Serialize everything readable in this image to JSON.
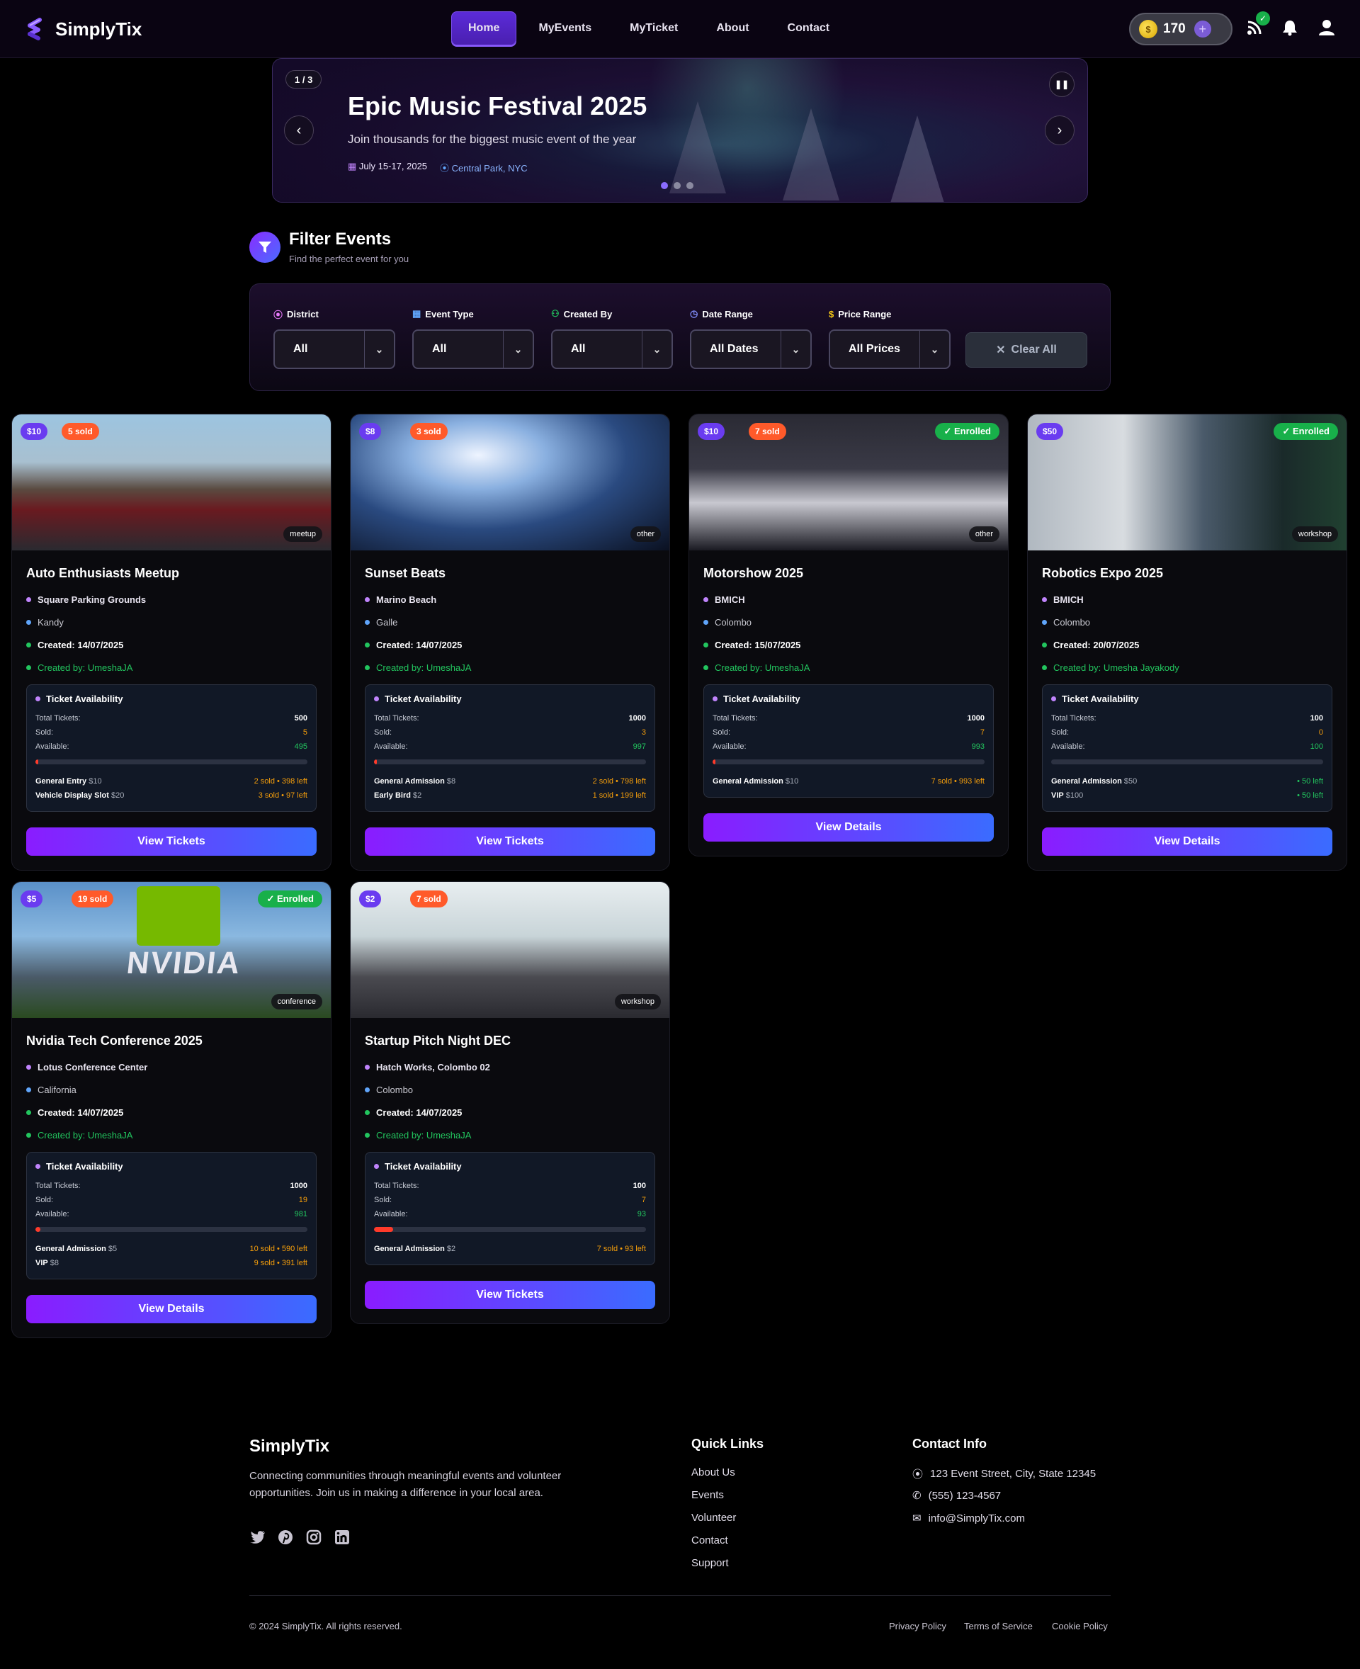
{
  "brand": "SimplyTix",
  "nav": {
    "links": [
      "Home",
      "MyEvents",
      "MyTicket",
      "About",
      "Contact"
    ],
    "active": "Home"
  },
  "coins": "170",
  "hero": {
    "counter": "1 / 3",
    "title": "Epic Music Festival 2025",
    "subtitle": "Join thousands for the biggest music event of the year",
    "date": "July 15-17, 2025",
    "location": "Central Park, NYC"
  },
  "filter": {
    "title": "Filter Events",
    "subtitle": "Find the perfect event for you",
    "groups": [
      {
        "label": "District",
        "value": "All",
        "icon": "map-pin-icon",
        "color": "#e879f9"
      },
      {
        "label": "Event Type",
        "value": "All",
        "icon": "calendar-icon",
        "color": "#60a5fa"
      },
      {
        "label": "Created By",
        "value": "All",
        "icon": "users-icon",
        "color": "#22c55e"
      },
      {
        "label": "Date Range",
        "value": "All Dates",
        "icon": "clock-icon",
        "color": "#818cf8"
      },
      {
        "label": "Price Range",
        "value": "All Prices",
        "icon": "dollar-icon",
        "color": "#facc15"
      }
    ],
    "clear": "Clear All"
  },
  "events": [
    {
      "price": "$10",
      "sold_badge": "5 sold",
      "enrolled": "",
      "type": "meetup",
      "title": "Auto Enthusiasts Meetup",
      "venue": "Square Parking Grounds",
      "city": "Kandy",
      "created": "Created: 14/07/2025",
      "creator": "Created by: UmeshaJA",
      "availability_title": "Ticket Availability",
      "total": "500",
      "sold": "5",
      "available": "495",
      "sold_fraction": 0.01,
      "tiers": [
        {
          "name": "General Entry",
          "price": "$10",
          "status": "2 sold • 398 left"
        },
        {
          "name": "Vehicle Display Slot",
          "price": "$20",
          "status": "3 sold • 97 left"
        }
      ],
      "button": "View Tickets"
    },
    {
      "price": "$8",
      "sold_badge": "3 sold",
      "enrolled": "",
      "type": "other",
      "title": "Sunset Beats",
      "venue": "Marino Beach",
      "city": "Galle",
      "created": "Created: 14/07/2025",
      "creator": "Created by: UmeshaJA",
      "availability_title": "Ticket Availability",
      "total": "1000",
      "sold": "3",
      "available": "997",
      "sold_fraction": 0.003,
      "tiers": [
        {
          "name": "General Admission",
          "price": "$8",
          "status": "2 sold • 798 left"
        },
        {
          "name": "Early Bird",
          "price": "$2",
          "status": "1 sold • 199 left"
        }
      ],
      "button": "View Tickets"
    },
    {
      "price": "$10",
      "sold_badge": "7 sold",
      "enrolled": "✓ Enrolled",
      "type": "other",
      "title": "Motorshow 2025",
      "venue": "BMICH",
      "city": "Colombo",
      "created": "Created: 15/07/2025",
      "creator": "Created by: UmeshaJA",
      "availability_title": "Ticket Availability",
      "total": "1000",
      "sold": "7",
      "available": "993",
      "sold_fraction": 0.007,
      "tiers": [
        {
          "name": "General Admission",
          "price": "$10",
          "status": "7 sold • 993 left"
        }
      ],
      "button": "View Details"
    },
    {
      "price": "$50",
      "sold_badge": "",
      "enrolled": "✓ Enrolled",
      "type": "workshop",
      "title": "Robotics Expo 2025",
      "venue": "BMICH",
      "city": "Colombo",
      "created": "Created: 20/07/2025",
      "creator": "Created by: Umesha Jayakody",
      "availability_title": "Ticket Availability",
      "total": "100",
      "sold": "0",
      "available": "100",
      "sold_fraction": 0,
      "tiers": [
        {
          "name": "General Admission",
          "price": "$50",
          "status": "• 50 left"
        },
        {
          "name": "VIP",
          "price": "$100",
          "status": "• 50 left"
        }
      ],
      "button": "View Details"
    },
    {
      "price": "$5",
      "sold_badge": "19 sold",
      "enrolled": "✓ Enrolled",
      "type": "conference",
      "title": "Nvidia Tech Conference 2025",
      "venue": "Lotus Conference Center",
      "city": "California",
      "created": "Created: 14/07/2025",
      "creator": "Created by: UmeshaJA",
      "availability_title": "Ticket Availability",
      "total": "1000",
      "sold": "19",
      "available": "981",
      "sold_fraction": 0.019,
      "tiers": [
        {
          "name": "General Admission",
          "price": "$5",
          "status": "10 sold • 590 left"
        },
        {
          "name": "VIP",
          "price": "$8",
          "status": "9 sold • 391 left"
        }
      ],
      "button": "View Details",
      "image_text": "NVIDIA"
    },
    {
      "price": "$2",
      "sold_badge": "7 sold",
      "enrolled": "",
      "type": "workshop",
      "title": "Startup Pitch Night DEC",
      "venue": "Hatch Works, Colombo 02",
      "city": "Colombo",
      "created": "Created: 14/07/2025",
      "creator": "Created by: UmeshaJA",
      "availability_title": "Ticket Availability",
      "total": "100",
      "sold": "7",
      "available": "93",
      "sold_fraction": 0.07,
      "tiers": [
        {
          "name": "General Admission",
          "price": "$2",
          "status": "7 sold • 93 left"
        }
      ],
      "button": "View Tickets"
    }
  ],
  "labels": {
    "total": "Total Tickets:",
    "sold": "Sold:",
    "available": "Available:"
  },
  "footer": {
    "brand": "SimplyTix",
    "description": "Connecting communities through meaningful events and volunteer opportunities. Join us in making a difference in your local area.",
    "quick_links_title": "Quick Links",
    "quick_links": [
      "About Us",
      "Events",
      "Volunteer",
      "Contact",
      "Support"
    ],
    "contact_title": "Contact Info",
    "address": "123 Event Street, City, State 12345",
    "phone": "(555) 123-4567",
    "email": "info@SimplyTix.com",
    "copyright": "© 2024 SimplyTix. All rights reserved.",
    "legal": [
      "Privacy Policy",
      "Terms of Service",
      "Cookie Policy"
    ]
  }
}
